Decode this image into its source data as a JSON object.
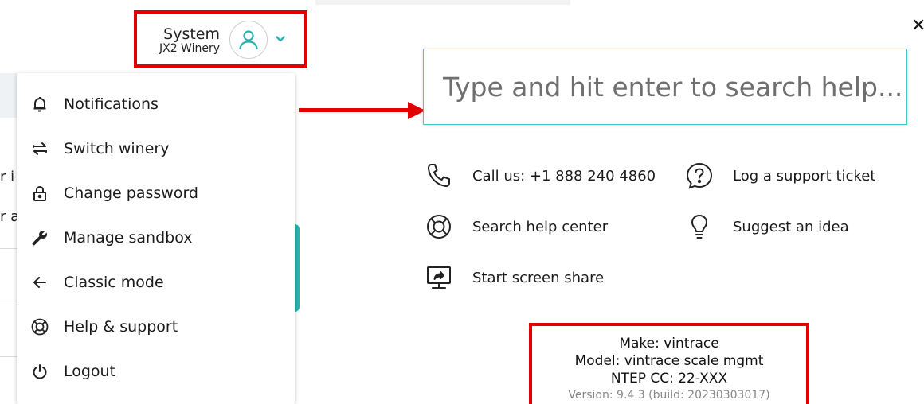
{
  "header": {
    "user_name": "System",
    "winery_name": "JX2 Winery"
  },
  "menu": {
    "items": [
      {
        "label": "Notifications",
        "icon": "bell-icon"
      },
      {
        "label": "Switch winery",
        "icon": "switch-arrows-icon"
      },
      {
        "label": "Change password",
        "icon": "lock-icon"
      },
      {
        "label": "Manage sandbox",
        "icon": "wrench-icon"
      },
      {
        "label": "Classic mode",
        "icon": "arrow-left-icon"
      },
      {
        "label": "Help & support",
        "icon": "lifebuoy-icon"
      },
      {
        "label": "Logout",
        "icon": "power-icon"
      }
    ]
  },
  "background_fragments": [
    "r i",
    "r a"
  ],
  "search": {
    "placeholder": "Type and hit enter to search help..."
  },
  "help_actions": {
    "call": "Call us: +1 888 240 4860",
    "ticket": "Log a support ticket",
    "help_center": "Search help center",
    "idea": "Suggest an idea",
    "screen_share": "Start screen share"
  },
  "version_info": {
    "make": "Make: vintrace",
    "model": "Model: vintrace scale mgmt",
    "ntep": "NTEP CC: 22-XXX",
    "version": "Version: 9.4.3 (build: 20230303017)"
  },
  "colors": {
    "accent": "#2ab3b0",
    "highlight": "#e30000",
    "search_border": "#48c9c4"
  }
}
